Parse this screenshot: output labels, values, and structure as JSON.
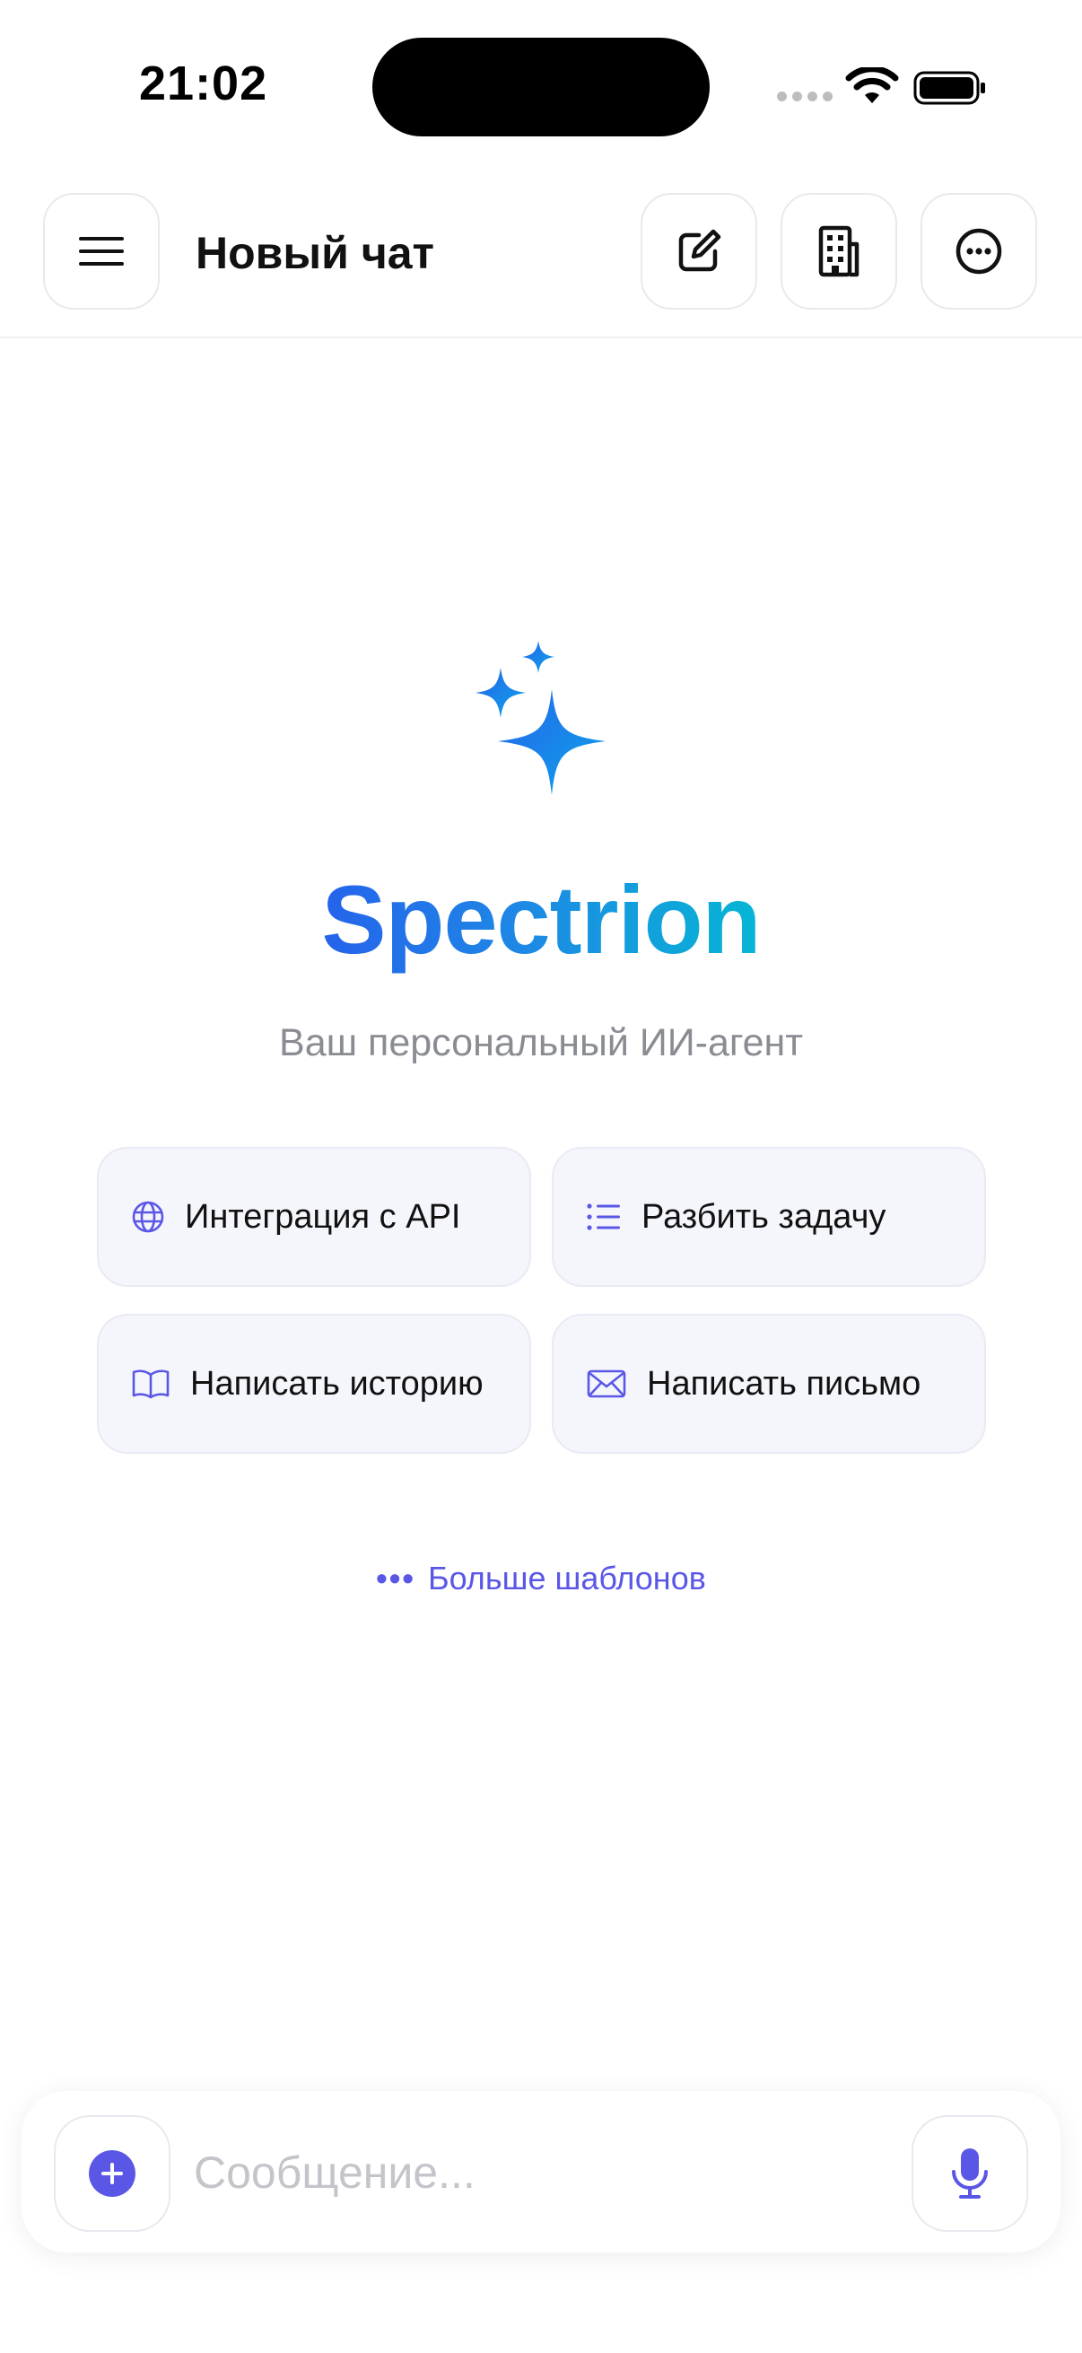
{
  "status_bar": {
    "time": "21:02"
  },
  "header": {
    "title": "Новый чат"
  },
  "hero": {
    "brand": "Spectrion",
    "subtitle": "Ваш персональный ИИ-агент"
  },
  "templates": [
    {
      "label": "Интеграция с API",
      "icon": "globe-icon"
    },
    {
      "label": "Разбить задачу",
      "icon": "list-icon"
    },
    {
      "label": "Написать историю",
      "icon": "book-icon"
    },
    {
      "label": "Написать письмо",
      "icon": "envelope-icon"
    }
  ],
  "more_templates": {
    "label": "Больше шаблонов"
  },
  "composer": {
    "placeholder": "Сообщение..."
  },
  "colors": {
    "accent": "#5b57e6",
    "brand_start": "#2563eb",
    "brand_end": "#06b6d4",
    "card_bg": "#f5f6fc"
  }
}
